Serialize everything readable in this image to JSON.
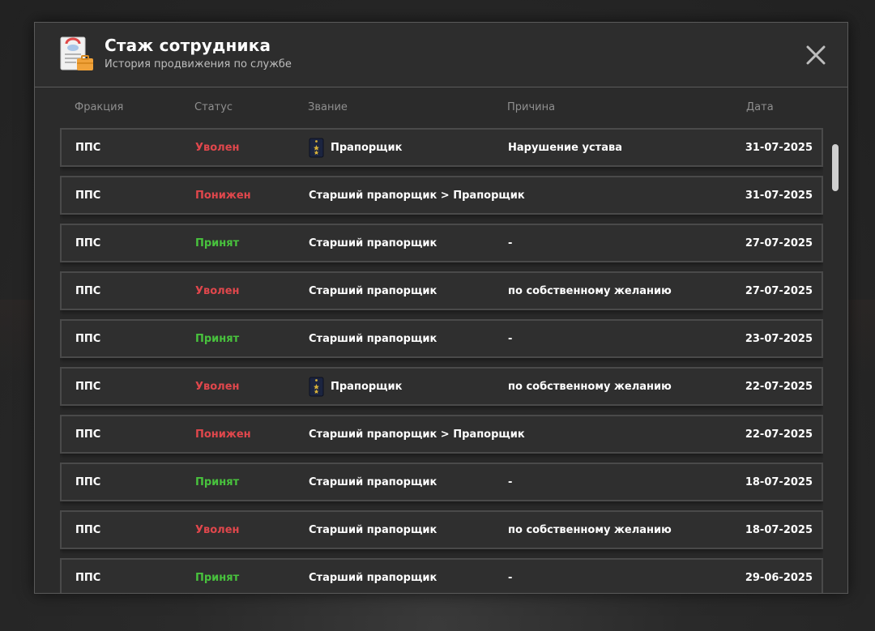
{
  "modal": {
    "title": "Стаж сотрудника",
    "subtitle": "История продвижения по службе",
    "header_icon": "document-briefcase-icon",
    "close_icon": "close-icon"
  },
  "columns": {
    "faction": "Фракция",
    "status": "Статус",
    "rank": "Звание",
    "reason": "Причина",
    "date": "Дата"
  },
  "colors": {
    "status_red": "#e0474c",
    "status_green": "#48c23d",
    "badge_blue": "#1b2440",
    "badge_star": "#d8b23a"
  },
  "rows": [
    {
      "faction": "ППС",
      "status": "Уволен",
      "status_color": "red",
      "rank": "Прапорщик",
      "rank_badge": true,
      "reason": "Нарушение устава",
      "date": "31-07-2025"
    },
    {
      "faction": "ППС",
      "status": "Понижен",
      "status_color": "red",
      "rank": "Старший прапорщик > Прапорщик",
      "rank_badge": false,
      "reason": "",
      "date": "31-07-2025"
    },
    {
      "faction": "ППС",
      "status": "Принят",
      "status_color": "green",
      "rank": "Старший прапорщик",
      "rank_badge": false,
      "reason": "-",
      "date": "27-07-2025"
    },
    {
      "faction": "ППС",
      "status": "Уволен",
      "status_color": "red",
      "rank": "Старший прапорщик",
      "rank_badge": false,
      "reason": "по собственному желанию",
      "date": "27-07-2025"
    },
    {
      "faction": "ППС",
      "status": "Принят",
      "status_color": "green",
      "rank": "Старший прапорщик",
      "rank_badge": false,
      "reason": "-",
      "date": "23-07-2025"
    },
    {
      "faction": "ППС",
      "status": "Уволен",
      "status_color": "red",
      "rank": "Прапорщик",
      "rank_badge": true,
      "reason": "по собственному желанию",
      "date": "22-07-2025"
    },
    {
      "faction": "ППС",
      "status": "Понижен",
      "status_color": "red",
      "rank": "Старший прапорщик > Прапорщик",
      "rank_badge": false,
      "reason": "",
      "date": "22-07-2025"
    },
    {
      "faction": "ППС",
      "status": "Принят",
      "status_color": "green",
      "rank": "Старший прапорщик",
      "rank_badge": false,
      "reason": "-",
      "date": "18-07-2025"
    },
    {
      "faction": "ППС",
      "status": "Уволен",
      "status_color": "red",
      "rank": "Старший прапорщик",
      "rank_badge": false,
      "reason": "по собственному желанию",
      "date": "18-07-2025"
    },
    {
      "faction": "ППС",
      "status": "Принят",
      "status_color": "green",
      "rank": "Старший прапорщик",
      "rank_badge": false,
      "reason": "-",
      "date": "29-06-2025"
    }
  ]
}
